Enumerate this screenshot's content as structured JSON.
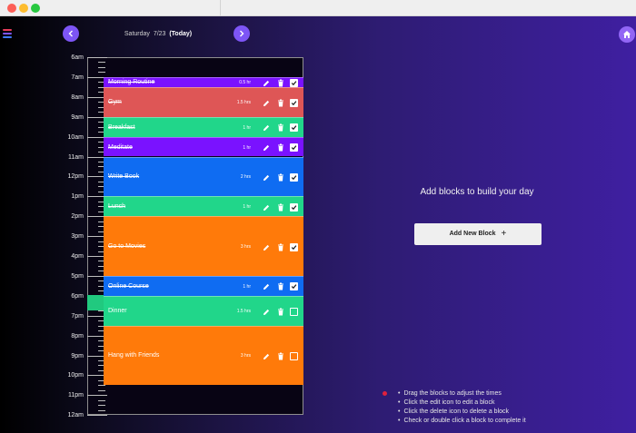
{
  "window": {
    "controls": [
      {
        "name": "close",
        "color": "#fc5f57"
      },
      {
        "name": "minimize",
        "color": "#fdbc2e"
      },
      {
        "name": "maximize",
        "color": "#28c840"
      }
    ]
  },
  "header": {
    "menu_icon": "hamburger-menu-icon",
    "menu_colors": [
      "#e63c5a",
      "#7d55f5",
      "#3e7bff"
    ],
    "prev_icon": "chevron-left-icon",
    "next_icon": "chevron-right-icon",
    "home_icon": "home-icon",
    "day": "Saturday",
    "date": "7/23",
    "today_label": "(Today)"
  },
  "timeline": {
    "hours": [
      "6am",
      "7am",
      "8am",
      "9am",
      "10am",
      "11am",
      "12pm",
      "1pm",
      "2pm",
      "3pm",
      "4pm",
      "5pm",
      "6pm",
      "7pm",
      "8pm",
      "9pm",
      "10pm",
      "11pm",
      "12am"
    ],
    "blocks": [
      {
        "title": "Morning Routine",
        "duration": "0.5 hr",
        "start": 7.0,
        "end": 7.5,
        "color": "#7a12ff",
        "completed": true
      },
      {
        "title": "Gym",
        "duration": "1.5 hrs",
        "start": 7.5,
        "end": 9.0,
        "color": "#de5656",
        "completed": true
      },
      {
        "title": "Breakfast",
        "duration": "1 hr",
        "start": 9.0,
        "end": 10.0,
        "color": "#21d68a",
        "completed": true
      },
      {
        "title": "Meditate",
        "duration": "1 hr",
        "start": 10.0,
        "end": 11.0,
        "color": "#7a12ff",
        "completed": true
      },
      {
        "title": "Write Book",
        "duration": "2 hrs",
        "start": 11.0,
        "end": 13.0,
        "color": "#0f6cf2",
        "completed": true
      },
      {
        "title": "Lunch",
        "duration": "1 hr",
        "start": 13.0,
        "end": 14.0,
        "color": "#21d68a",
        "completed": true
      },
      {
        "title": "Go to Movies",
        "duration": "3 hrs",
        "start": 14.0,
        "end": 17.0,
        "color": "#ff7a0a",
        "completed": true
      },
      {
        "title": "Online Course",
        "duration": "1 hr",
        "start": 17.0,
        "end": 18.0,
        "color": "#0f6cf2",
        "completed": true
      },
      {
        "title": "Dinner",
        "duration": "1.5 hrs",
        "start": 18.0,
        "end": 19.5,
        "color": "#21d68a",
        "completed": false
      },
      {
        "title": "Hang with Friends",
        "duration": "3 hrs",
        "start": 19.5,
        "end": 22.5,
        "color": "#ff7a0a",
        "completed": false
      }
    ],
    "action_icons": [
      "edit-pencil-icon",
      "trash-icon",
      "checkbox-icon"
    ]
  },
  "main": {
    "empty_message": "Add blocks to build your day",
    "add_button_label": "Add New Block",
    "add_button_icon": "+",
    "instructions": [
      "Drag the blocks to adjust the times",
      "Click the edit icon to edit a block",
      "Click the delete icon to delete a block",
      "Check or double click a block to complete it"
    ]
  }
}
